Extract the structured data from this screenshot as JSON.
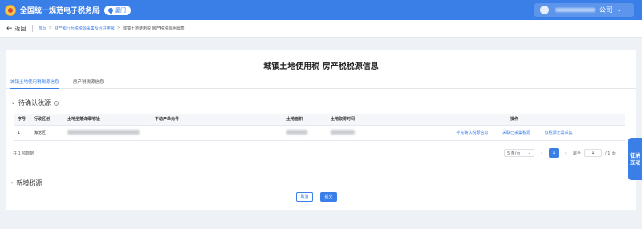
{
  "header": {
    "app_title": "全国统一规范电子税务局",
    "city": "厦门",
    "user_suffix": "公司",
    "caret": "⌄"
  },
  "breadcrumb": {
    "back": "返回",
    "items": [
      "首页",
      "财产和行为税税源采集及合并申报",
      "城镇土地使用税 房产税税源明细表"
    ],
    "separators": [
      ">",
      ">"
    ]
  },
  "page": {
    "title": "城镇土地使用税 房产税税源信息",
    "tabs": [
      "城镇土地使用税税源信息",
      "房产税税源信息"
    ]
  },
  "pending": {
    "title": "待确认税源",
    "info": "i"
  },
  "table": {
    "headers": [
      "序号",
      "行政区划",
      "土地坐落详细地址",
      "不动产单元号",
      "土地面积",
      "土地取得时间",
      "操作"
    ],
    "rows": [
      {
        "index": "1",
        "district": "海沧区",
        "actions": [
          "补充确认税源信息",
          "关联已采集税源",
          "该税源无需采集"
        ]
      }
    ]
  },
  "pagination": {
    "total": "共 1 项数据",
    "page_size": "5 条/页",
    "prev": "‹",
    "next": "›",
    "current_page": "1",
    "jump_label": "跳至",
    "jump_value": "1",
    "page_suffix": "/ 1 页",
    "dropdown_caret": "⌄"
  },
  "new_source": {
    "title": "新增税源"
  },
  "buttons": {
    "cancel": "取消",
    "submit": "提交"
  },
  "float_tab": {
    "line1": "征纳",
    "line2": "互动"
  },
  "colors": {
    "primary": "#3a7ee8",
    "background": "#eef1f6"
  }
}
